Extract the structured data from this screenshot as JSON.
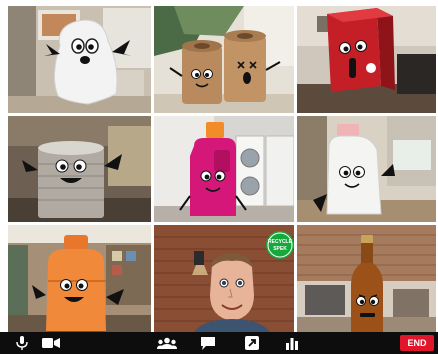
{
  "participants": [
    {
      "name": "ghost-participant",
      "character": "paper-ghost"
    },
    {
      "name": "toilet-rolls-participant",
      "character": "toilet-roll-pair"
    },
    {
      "name": "red-carton-participant",
      "character": "red-carton"
    },
    {
      "name": "tin-can-participant",
      "character": "tin-can"
    },
    {
      "name": "pink-bottle-participant",
      "character": "pink-detergent-bottle"
    },
    {
      "name": "milk-jug-participant",
      "character": "milk-jug"
    },
    {
      "name": "orange-bottle-participant",
      "character": "orange-bottle"
    },
    {
      "name": "human-participant",
      "character": "person",
      "sign": "RECYCLE SPEK"
    },
    {
      "name": "brown-bottle-participant",
      "character": "brown-beer-bottle"
    }
  ],
  "toolbar": {
    "buttons": [
      "microphone-icon",
      "camera-icon",
      "participants-icon",
      "chat-icon",
      "share-icon",
      "stats-icon"
    ],
    "end_label": "END"
  },
  "colors": {
    "toolbar_bg": "#0d0d0d",
    "end_button": "#e0162b"
  }
}
